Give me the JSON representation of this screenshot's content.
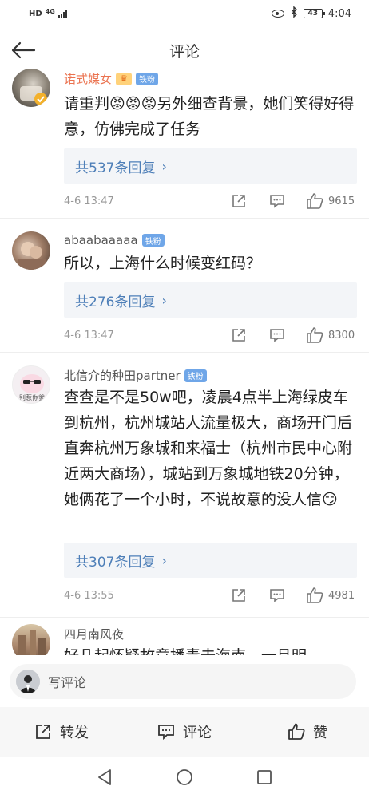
{
  "status_bar": {
    "network_hd": "HD",
    "network_type": "4G",
    "battery": "43",
    "time": "4:04"
  },
  "header": {
    "title": "评论"
  },
  "comments": [
    {
      "username": "诺式媒女",
      "badge": "铁粉",
      "text": "请重判😡😡😡另外细查背景，她们笑得好得意，仿佛完成了任务",
      "replies": "共537条回复",
      "time": "4-6 13:47",
      "likes": "9615"
    },
    {
      "username": "abaabaaaaa",
      "badge": "铁粉",
      "text": "所以，上海什么时候变红码？",
      "replies": "共276条回复",
      "time": "4-6 13:47",
      "likes": "8300"
    },
    {
      "username": "北信介的种田partner",
      "badge": "铁粉",
      "avatar_text": "别惹你爹",
      "text": "查查是不是50w吧，凌晨4点半上海绿皮车到杭州，杭州城站人流量极大，商场开门后直奔杭州万象城和来福士（杭州市民中心附近两大商场），城站到万象城地铁20分钟，她俩花了一个小时，不说故意的没人信😏",
      "replies": "共307条回复",
      "time": "4-6 13:55",
      "likes": "4981"
    },
    {
      "username": "四月南风夜",
      "text": "好几起怀疑故意播毒去海南，一旦明"
    }
  ],
  "write_bar": {
    "placeholder": "写评论"
  },
  "actions": {
    "repost": "转发",
    "comment": "评论",
    "like": "赞"
  }
}
